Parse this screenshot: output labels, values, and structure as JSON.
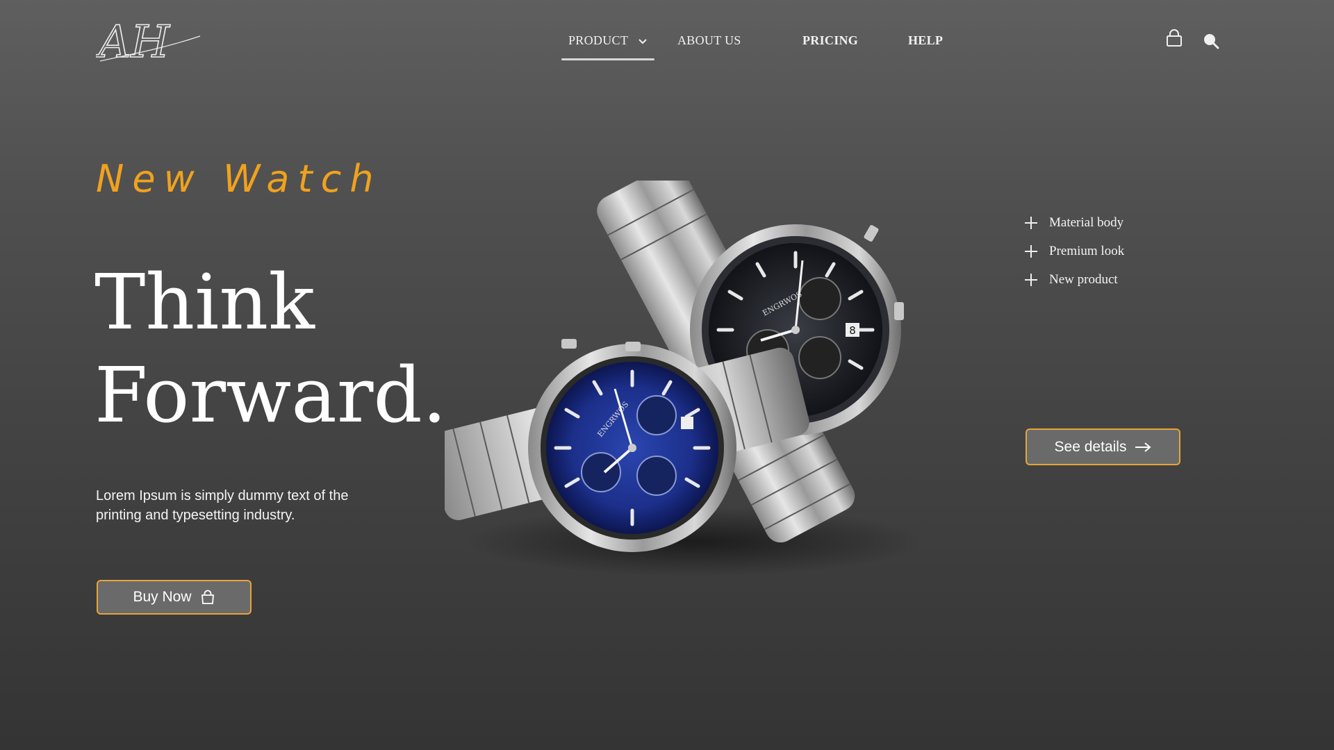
{
  "brand": {
    "logo_text": "AH"
  },
  "nav": {
    "items": [
      {
        "label": "PRODUCT",
        "active": true,
        "has_dropdown": true
      },
      {
        "label": "ABOUT US"
      },
      {
        "label": "PRICING"
      },
      {
        "label": "HELP"
      }
    ],
    "icons": [
      "shopping-bag-icon",
      "search-icon"
    ]
  },
  "hero": {
    "eyebrow": "New Watch",
    "headline_line1": "Think",
    "headline_line2": "Forward.",
    "description": "Lorem Ipsum is simply dummy text of the printing and typesetting industry.",
    "buy_button": "Buy Now"
  },
  "features": [
    {
      "label": "Material body"
    },
    {
      "label": "Premium look"
    },
    {
      "label": "New product"
    }
  ],
  "details_button": "See details",
  "watches": {
    "brand_text": "ENGRWOS",
    "date_number": "8"
  },
  "colors": {
    "accent": "#f0a21e",
    "button_border": "#e8a43a",
    "background_top": "#5f5f5f",
    "background_bottom": "#343434",
    "blue_dial": "#1c2f8a",
    "black_dial": "#1c1e24"
  }
}
